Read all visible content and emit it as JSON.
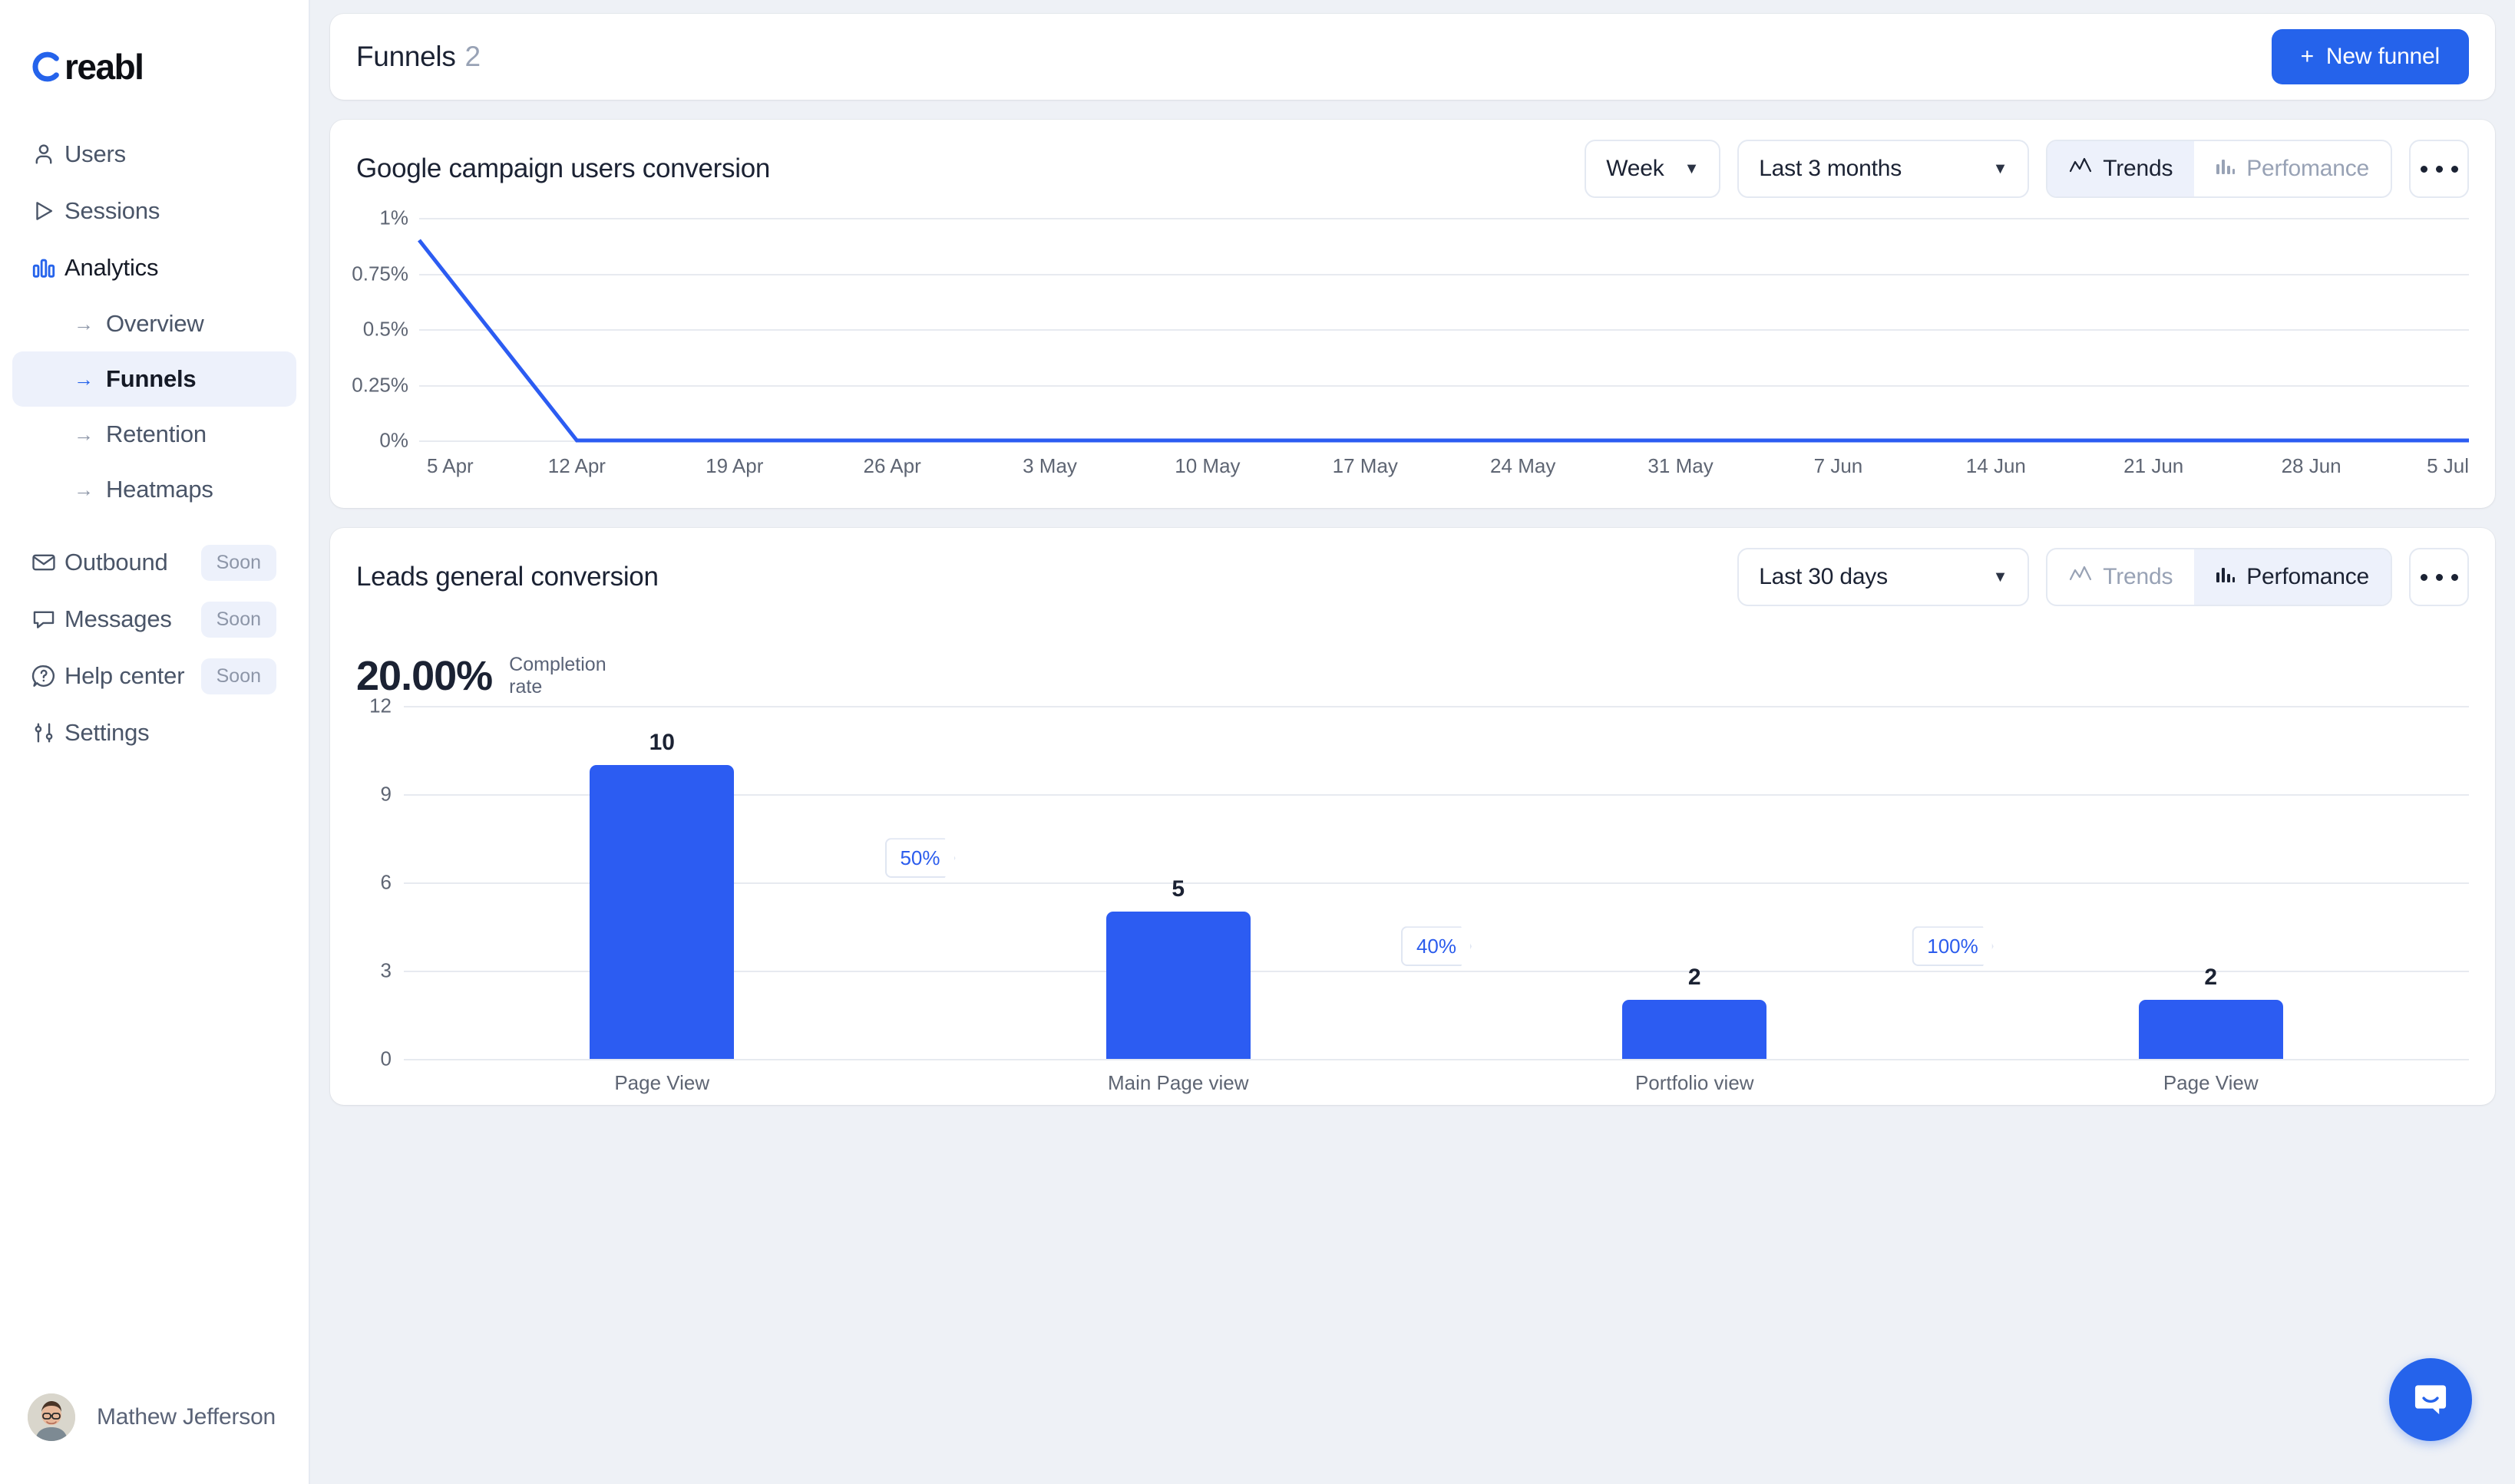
{
  "brand": {
    "name": "reabl",
    "accent": "#2563eb"
  },
  "sidebar": {
    "items": [
      {
        "label": "Users",
        "icon": "user-icon"
      },
      {
        "label": "Sessions",
        "icon": "play-icon"
      },
      {
        "label": "Analytics",
        "icon": "bar-chart-icon"
      }
    ],
    "sub_items": [
      {
        "label": "Overview"
      },
      {
        "label": "Funnels"
      },
      {
        "label": "Retention"
      },
      {
        "label": "Heatmaps"
      }
    ],
    "secondary_items": [
      {
        "label": "Outbound",
        "icon": "mail-icon",
        "badge": "Soon"
      },
      {
        "label": "Messages",
        "icon": "chat-icon",
        "badge": "Soon"
      },
      {
        "label": "Help center",
        "icon": "question-icon",
        "badge": "Soon"
      }
    ],
    "settings": {
      "label": "Settings",
      "icon": "sliders-icon"
    },
    "profile": {
      "name": "Mathew Jefferson"
    }
  },
  "header": {
    "title": "Funnels",
    "count": "2",
    "new_funnel_label": "New funnel",
    "new_funnel_plus": "+"
  },
  "cards": [
    {
      "title": "Google campaign users conversion",
      "granularity": "Week",
      "range": "Last 3 months",
      "tab_trends": "Trends",
      "tab_performance": "Perfomance",
      "active_tab": "Trends"
    },
    {
      "title": "Leads general conversion",
      "range": "Last 30 days",
      "tab_trends": "Trends",
      "tab_performance": "Perfomance",
      "active_tab": "Perfomance",
      "completion_value": "20.00%",
      "completion_label": "Completion rate"
    }
  ],
  "chart_data": [
    {
      "type": "line",
      "title": "Google campaign users conversion",
      "xlabel": "",
      "ylabel": "",
      "ylim": [
        0,
        1
      ],
      "yticks": [
        0,
        0.25,
        0.5,
        0.75,
        1
      ],
      "ytick_labels": [
        "0%",
        "0.25%",
        "0.5%",
        "0.75%",
        "1%"
      ],
      "grid": true,
      "legend": "none",
      "x": [
        "5 Apr",
        "12 Apr",
        "19 Apr",
        "26 Apr",
        "3 May",
        "10 May",
        "17 May",
        "24 May",
        "31 May",
        "7 Jun",
        "14 Jun",
        "21 Jun",
        "28 Jun",
        "5 Jul"
      ],
      "series": [
        {
          "name": "conversion",
          "color": "#2c5cf2",
          "values": [
            0.9,
            0,
            0,
            0,
            0,
            0,
            0,
            0,
            0,
            0,
            0,
            0,
            0,
            0
          ]
        }
      ]
    },
    {
      "type": "bar",
      "title": "Leads general conversion",
      "xlabel": "",
      "ylabel": "",
      "ylim": [
        0,
        12
      ],
      "yticks": [
        0,
        3,
        6,
        9,
        12
      ],
      "ytick_labels": [
        "0",
        "3",
        "6",
        "9",
        "12"
      ],
      "grid": true,
      "legend": "none",
      "bar_color": "#2c5cf2",
      "categories": [
        "Page View",
        "Main Page view",
        "Portfolio view",
        "Page View"
      ],
      "values": [
        10,
        5,
        2,
        2
      ],
      "value_labels": [
        "10",
        "5",
        "2",
        "2"
      ],
      "step_conversions": [
        "50%",
        "40%",
        "100%"
      ],
      "completion_rate": "20.00%"
    }
  ],
  "chat": {
    "label": "chat-launcher"
  }
}
